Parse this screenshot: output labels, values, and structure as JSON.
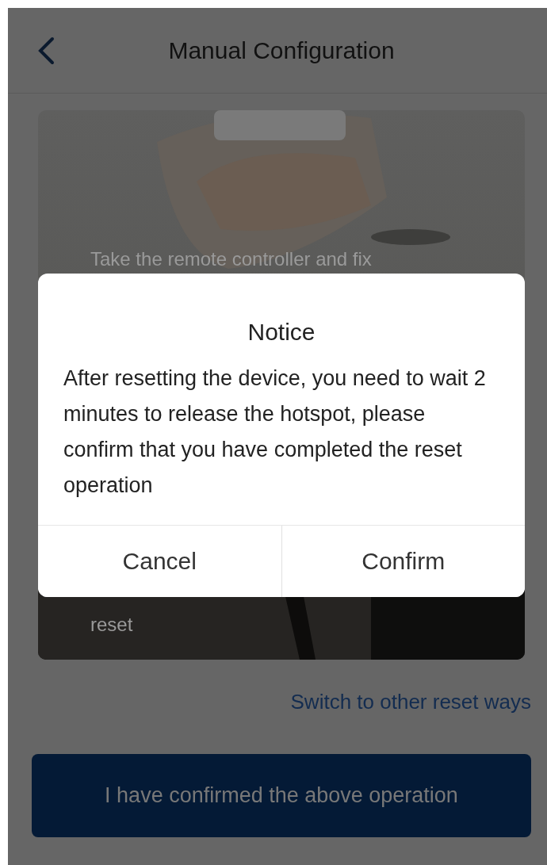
{
  "header": {
    "title": "Manual Configuration"
  },
  "instruction_card": {
    "texts": [
      "Take the remote controller and fix",
      "reset"
    ]
  },
  "switch_link": "Switch to other reset ways",
  "primary_button": "I have confirmed the above operation",
  "dialog": {
    "title": "Notice",
    "message": "After resetting the device, you need to wait 2 minutes to release the hotspot, please confirm that you have completed the reset operation",
    "buttons": [
      "Cancel",
      "Confirm"
    ]
  }
}
